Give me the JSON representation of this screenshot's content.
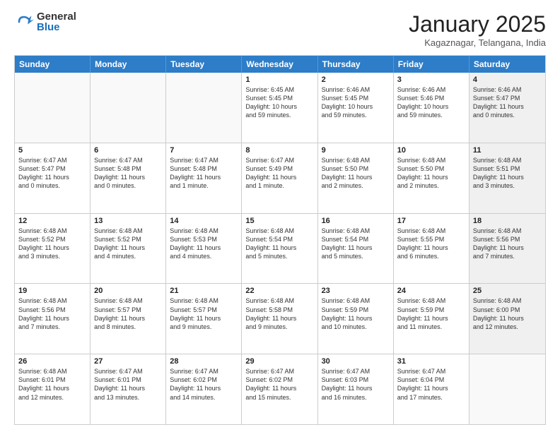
{
  "logo": {
    "general": "General",
    "blue": "Blue"
  },
  "header": {
    "title": "January 2025",
    "location": "Kagaznagar, Telangana, India"
  },
  "weekdays": [
    "Sunday",
    "Monday",
    "Tuesday",
    "Wednesday",
    "Thursday",
    "Friday",
    "Saturday"
  ],
  "rows": [
    [
      {
        "day": "",
        "lines": [],
        "empty": true
      },
      {
        "day": "",
        "lines": [],
        "empty": true
      },
      {
        "day": "",
        "lines": [],
        "empty": true
      },
      {
        "day": "1",
        "lines": [
          "Sunrise: 6:45 AM",
          "Sunset: 5:45 PM",
          "Daylight: 10 hours",
          "and 59 minutes."
        ]
      },
      {
        "day": "2",
        "lines": [
          "Sunrise: 6:46 AM",
          "Sunset: 5:45 PM",
          "Daylight: 10 hours",
          "and 59 minutes."
        ]
      },
      {
        "day": "3",
        "lines": [
          "Sunrise: 6:46 AM",
          "Sunset: 5:46 PM",
          "Daylight: 10 hours",
          "and 59 minutes."
        ]
      },
      {
        "day": "4",
        "lines": [
          "Sunrise: 6:46 AM",
          "Sunset: 5:47 PM",
          "Daylight: 11 hours",
          "and 0 minutes."
        ],
        "shaded": true
      }
    ],
    [
      {
        "day": "5",
        "lines": [
          "Sunrise: 6:47 AM",
          "Sunset: 5:47 PM",
          "Daylight: 11 hours",
          "and 0 minutes."
        ]
      },
      {
        "day": "6",
        "lines": [
          "Sunrise: 6:47 AM",
          "Sunset: 5:48 PM",
          "Daylight: 11 hours",
          "and 0 minutes."
        ]
      },
      {
        "day": "7",
        "lines": [
          "Sunrise: 6:47 AM",
          "Sunset: 5:48 PM",
          "Daylight: 11 hours",
          "and 1 minute."
        ]
      },
      {
        "day": "8",
        "lines": [
          "Sunrise: 6:47 AM",
          "Sunset: 5:49 PM",
          "Daylight: 11 hours",
          "and 1 minute."
        ]
      },
      {
        "day": "9",
        "lines": [
          "Sunrise: 6:48 AM",
          "Sunset: 5:50 PM",
          "Daylight: 11 hours",
          "and 2 minutes."
        ]
      },
      {
        "day": "10",
        "lines": [
          "Sunrise: 6:48 AM",
          "Sunset: 5:50 PM",
          "Daylight: 11 hours",
          "and 2 minutes."
        ]
      },
      {
        "day": "11",
        "lines": [
          "Sunrise: 6:48 AM",
          "Sunset: 5:51 PM",
          "Daylight: 11 hours",
          "and 3 minutes."
        ],
        "shaded": true
      }
    ],
    [
      {
        "day": "12",
        "lines": [
          "Sunrise: 6:48 AM",
          "Sunset: 5:52 PM",
          "Daylight: 11 hours",
          "and 3 minutes."
        ]
      },
      {
        "day": "13",
        "lines": [
          "Sunrise: 6:48 AM",
          "Sunset: 5:52 PM",
          "Daylight: 11 hours",
          "and 4 minutes."
        ]
      },
      {
        "day": "14",
        "lines": [
          "Sunrise: 6:48 AM",
          "Sunset: 5:53 PM",
          "Daylight: 11 hours",
          "and 4 minutes."
        ]
      },
      {
        "day": "15",
        "lines": [
          "Sunrise: 6:48 AM",
          "Sunset: 5:54 PM",
          "Daylight: 11 hours",
          "and 5 minutes."
        ]
      },
      {
        "day": "16",
        "lines": [
          "Sunrise: 6:48 AM",
          "Sunset: 5:54 PM",
          "Daylight: 11 hours",
          "and 5 minutes."
        ]
      },
      {
        "day": "17",
        "lines": [
          "Sunrise: 6:48 AM",
          "Sunset: 5:55 PM",
          "Daylight: 11 hours",
          "and 6 minutes."
        ]
      },
      {
        "day": "18",
        "lines": [
          "Sunrise: 6:48 AM",
          "Sunset: 5:56 PM",
          "Daylight: 11 hours",
          "and 7 minutes."
        ],
        "shaded": true
      }
    ],
    [
      {
        "day": "19",
        "lines": [
          "Sunrise: 6:48 AM",
          "Sunset: 5:56 PM",
          "Daylight: 11 hours",
          "and 7 minutes."
        ]
      },
      {
        "day": "20",
        "lines": [
          "Sunrise: 6:48 AM",
          "Sunset: 5:57 PM",
          "Daylight: 11 hours",
          "and 8 minutes."
        ]
      },
      {
        "day": "21",
        "lines": [
          "Sunrise: 6:48 AM",
          "Sunset: 5:57 PM",
          "Daylight: 11 hours",
          "and 9 minutes."
        ]
      },
      {
        "day": "22",
        "lines": [
          "Sunrise: 6:48 AM",
          "Sunset: 5:58 PM",
          "Daylight: 11 hours",
          "and 9 minutes."
        ]
      },
      {
        "day": "23",
        "lines": [
          "Sunrise: 6:48 AM",
          "Sunset: 5:59 PM",
          "Daylight: 11 hours",
          "and 10 minutes."
        ]
      },
      {
        "day": "24",
        "lines": [
          "Sunrise: 6:48 AM",
          "Sunset: 5:59 PM",
          "Daylight: 11 hours",
          "and 11 minutes."
        ]
      },
      {
        "day": "25",
        "lines": [
          "Sunrise: 6:48 AM",
          "Sunset: 6:00 PM",
          "Daylight: 11 hours",
          "and 12 minutes."
        ],
        "shaded": true
      }
    ],
    [
      {
        "day": "26",
        "lines": [
          "Sunrise: 6:48 AM",
          "Sunset: 6:01 PM",
          "Daylight: 11 hours",
          "and 12 minutes."
        ]
      },
      {
        "day": "27",
        "lines": [
          "Sunrise: 6:47 AM",
          "Sunset: 6:01 PM",
          "Daylight: 11 hours",
          "and 13 minutes."
        ]
      },
      {
        "day": "28",
        "lines": [
          "Sunrise: 6:47 AM",
          "Sunset: 6:02 PM",
          "Daylight: 11 hours",
          "and 14 minutes."
        ]
      },
      {
        "day": "29",
        "lines": [
          "Sunrise: 6:47 AM",
          "Sunset: 6:02 PM",
          "Daylight: 11 hours",
          "and 15 minutes."
        ]
      },
      {
        "day": "30",
        "lines": [
          "Sunrise: 6:47 AM",
          "Sunset: 6:03 PM",
          "Daylight: 11 hours",
          "and 16 minutes."
        ]
      },
      {
        "day": "31",
        "lines": [
          "Sunrise: 6:47 AM",
          "Sunset: 6:04 PM",
          "Daylight: 11 hours",
          "and 17 minutes."
        ]
      },
      {
        "day": "",
        "lines": [],
        "empty": true
      }
    ]
  ]
}
